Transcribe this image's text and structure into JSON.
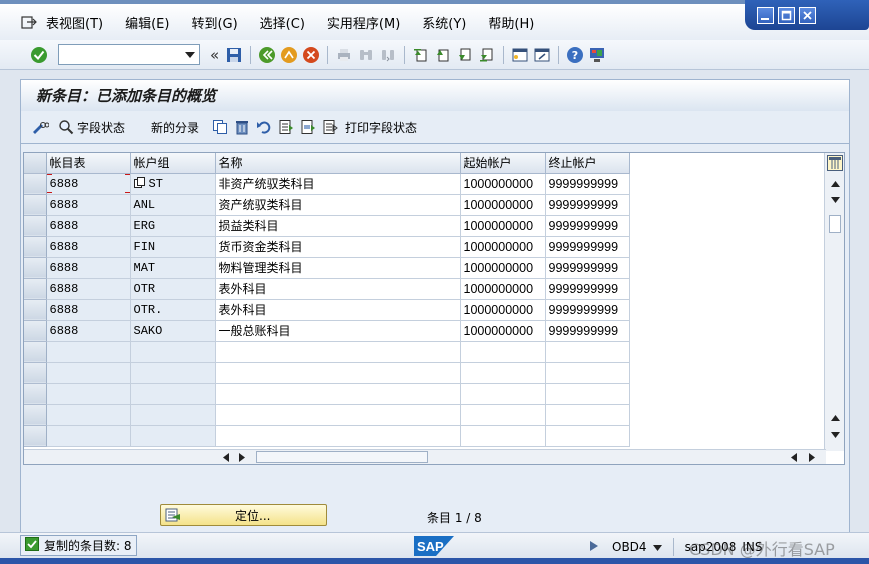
{
  "menu": {
    "items": [
      "表视图(T)",
      "编辑(E)",
      "转到(G)",
      "选择(C)",
      "实用程序(M)",
      "系统(Y)",
      "帮助(H)"
    ]
  },
  "toolbar": {
    "command_value": "",
    "chevron": "«"
  },
  "page": {
    "title": "新条目：已添加条目的概览"
  },
  "app_toolbar": {
    "field_status_label": "字段状态",
    "new_group_label": "新的分录",
    "print_field_status_label": "打印字段状态"
  },
  "table": {
    "columns": [
      "帐目表",
      "帐户组",
      "名称",
      "起始帐户",
      "终止帐户"
    ],
    "rows": [
      [
        "6888",
        "ST",
        "非资产统驭类科目",
        "1000000000",
        "9999999999"
      ],
      [
        "6888",
        "ANL",
        "资产统驭类科目",
        "1000000000",
        "9999999999"
      ],
      [
        "6888",
        "ERG",
        "损益类科目",
        "1000000000",
        "9999999999"
      ],
      [
        "6888",
        "FIN",
        "货币资金类科目",
        "1000000000",
        "9999999999"
      ],
      [
        "6888",
        "MAT",
        "物料管理类科目",
        "1000000000",
        "9999999999"
      ],
      [
        "6888",
        "OTR",
        "表外科目",
        "1000000000",
        "9999999999"
      ],
      [
        "6888",
        "OTR.",
        "表外科目",
        "1000000000",
        "9999999999"
      ],
      [
        "6888",
        "SAKO",
        "一般总账科目",
        "1000000000",
        "9999999999"
      ]
    ]
  },
  "footer": {
    "locate_label": "定位...",
    "entry_count": "条目 1 / 8"
  },
  "status": {
    "message": "复制的条目数: 8",
    "system": "OBD4",
    "server": "sap2008",
    "mode": "INS",
    "watermark": "CSDN @外行看SAP",
    "logo": "SAP"
  },
  "colors": {
    "accent": "#2f62b9",
    "frame": "#dfe6ef",
    "key_cell": "#e4ecf5",
    "locate_btn": "#f4e28a"
  }
}
